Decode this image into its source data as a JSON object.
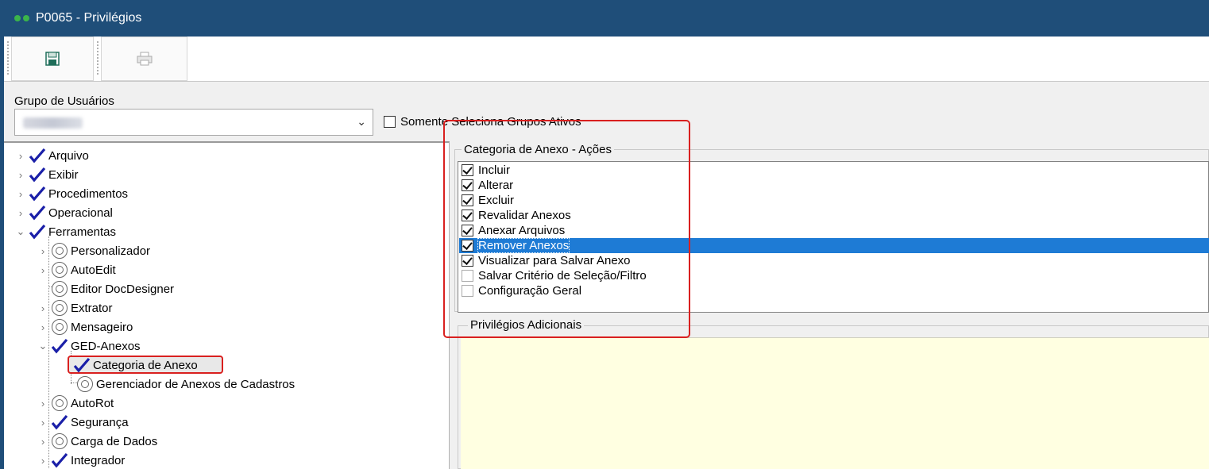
{
  "window": {
    "title": "P0065 - Privilégios"
  },
  "toolbar": {
    "save_icon": "save-icon",
    "print_icon": "print-icon"
  },
  "group": {
    "label": "Grupo de Usuários",
    "selected_value": "",
    "only_active_label": "Somente Seleciona Grupos Ativos",
    "only_active_checked": false
  },
  "tree": {
    "arquivo": "Arquivo",
    "exibir": "Exibir",
    "procedimentos": "Procedimentos",
    "operacional": "Operacional",
    "ferramentas": "Ferramentas",
    "personalizador": "Personalizador",
    "autoedit": "AutoEdit",
    "editor_docdesigner": "Editor DocDesigner",
    "extrator": "Extrator",
    "mensageiro": "Mensageiro",
    "ged_anexos": "GED-Anexos",
    "categoria_anexo": "Categoria de Anexo",
    "gerenciador_anexos": "Gerenciador de Anexos de Cadastros",
    "autorot": "AutoRot",
    "seguranca": "Segurança",
    "carga_dados": "Carga de Dados",
    "integrador": "Integrador"
  },
  "actions": {
    "title": "Categoria de Anexo - Ações",
    "items": [
      {
        "label": "Incluir",
        "checked": true
      },
      {
        "label": "Alterar",
        "checked": true
      },
      {
        "label": "Excluir",
        "checked": true
      },
      {
        "label": "Revalidar Anexos",
        "checked": true
      },
      {
        "label": "Anexar Arquivos",
        "checked": true
      },
      {
        "label": "Remover Anexos",
        "checked": true,
        "selected": true
      },
      {
        "label": "Visualizar para Salvar Anexo",
        "checked": true
      },
      {
        "label": "Salvar Critério de Seleção/Filtro",
        "checked": false
      },
      {
        "label": "Configuração Geral",
        "checked": false
      }
    ]
  },
  "extra": {
    "title": "Privilégios Adicionais"
  },
  "colors": {
    "titlebar": "#1f4e79",
    "selection": "#1e7bd5",
    "annotation": "#d9201f",
    "check": "#1a1fa8",
    "extra_bg": "#ffffe1"
  }
}
